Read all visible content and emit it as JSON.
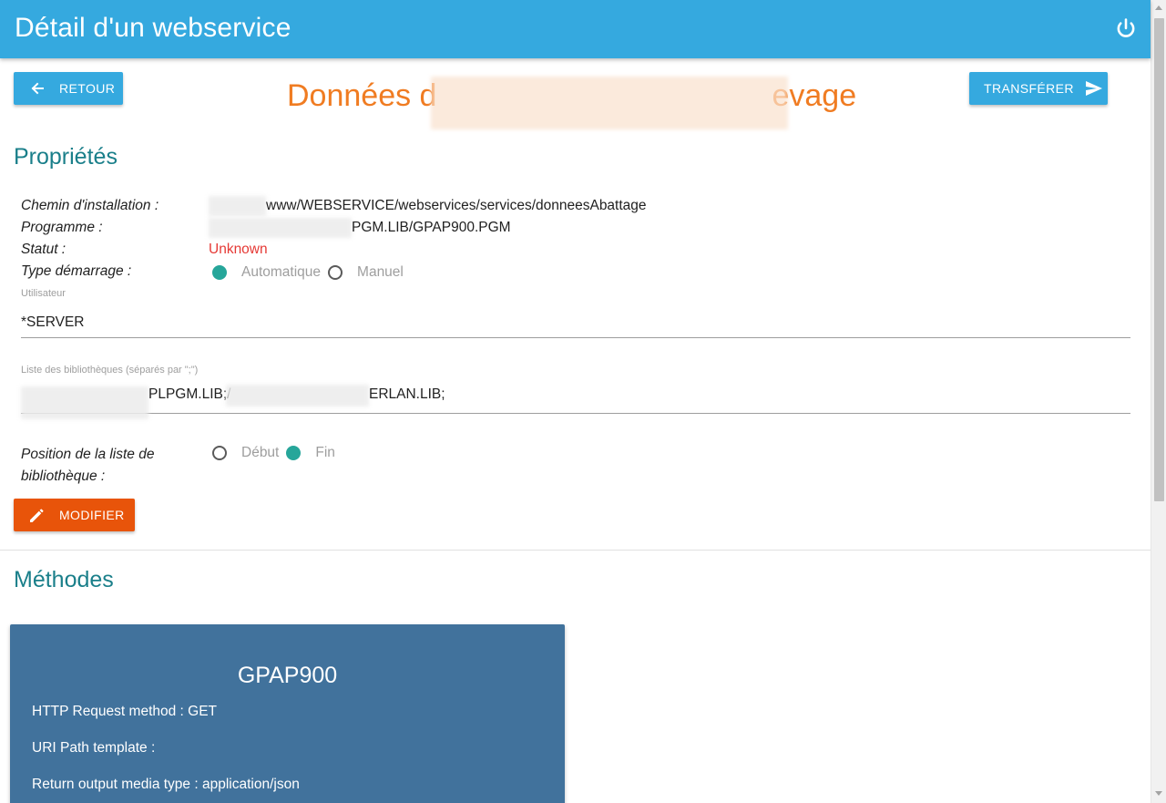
{
  "header": {
    "title": "Détail d'un webservice",
    "power_icon": "power-icon"
  },
  "toolbar": {
    "back_label": "Retour",
    "back_icon": "arrow-left-icon",
    "transfer_label": "Transférer",
    "transfer_icon": "send-icon"
  },
  "webservice": {
    "title_start": "Données d",
    "title_end": "evage"
  },
  "properties": {
    "section_title": "Propriétés",
    "install_path_label": "Chemin d'installation :",
    "install_path_value": "www/WEBSERVICE/webservices/services/donneesAbattage",
    "program_label": "Programme :",
    "program_value": "PGM.LIB/GPAP900.PGM",
    "status_label": "Statut :",
    "status_value": "Unknown",
    "startup_type_label": "Type démarrage :",
    "startup_options": [
      "Automatique",
      "Manuel"
    ],
    "startup_selected": "Automatique",
    "user_label": "Utilisateur",
    "user_value": "*SERVER",
    "libraries_label": "Liste des bibliothèques (séparés par \";\")",
    "libraries_visible_part1": "PLPGM.LIB;/",
    "libraries_visible_part2": "ERLAN.LIB;",
    "lib_position_label_line1": "Position de la liste de",
    "lib_position_label_line2": "bibliothèque :",
    "lib_position_options": [
      "Début",
      "Fin"
    ],
    "lib_position_selected": "Fin",
    "modify_label": "Modifier",
    "modify_icon": "pencil-icon"
  },
  "methods": {
    "section_title": "Méthodes",
    "items": [
      {
        "name": "GPAP900",
        "http_method_line": "HTTP Request method : GET",
        "uri_line": "URI Path template :",
        "media_type_line": "Return output media type : application/json"
      }
    ]
  },
  "colors": {
    "primary": "#35a9df",
    "accent": "#f07c22",
    "modify_button": "#e8540a",
    "section_title": "#1a7f8a",
    "card": "#41729c",
    "radio_checked": "#26a69a",
    "status_unknown": "#e53935"
  }
}
